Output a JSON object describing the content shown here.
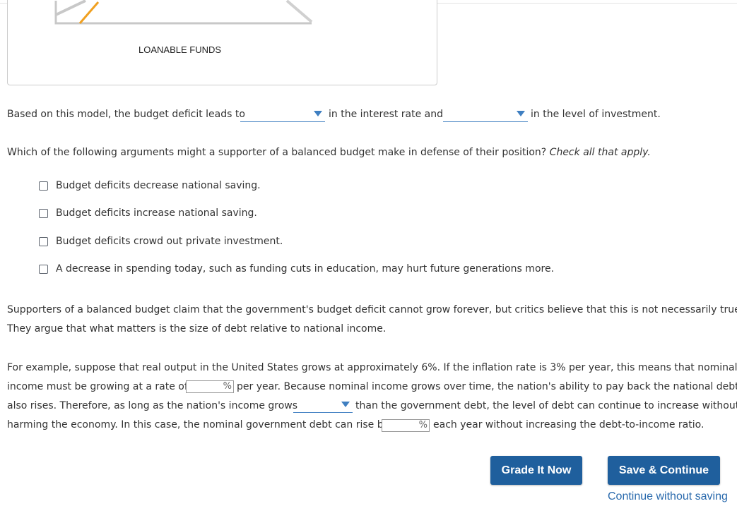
{
  "graph": {
    "x_axis_label": "LOANABLE FUNDS",
    "colors": {
      "curve": "#f0a020",
      "outline": "#c8c8c8"
    }
  },
  "q1": {
    "part1": "Based on this model, the budget deficit leads to",
    "part2": "in the interest rate and",
    "part3": "in the level of investment.",
    "dropdown1_value": "",
    "dropdown2_value": ""
  },
  "q2": {
    "prompt": "Which of the following arguments might a supporter of a balanced budget make in defense of their position?",
    "instruction": "Check all that apply.",
    "options": [
      "Budget deficits decrease national saving.",
      "Budget deficits increase national saving.",
      "Budget deficits crowd out private investment.",
      "A decrease in spending today, such as funding cuts in education, may hurt future generations more."
    ]
  },
  "para1": {
    "line1": "Supporters of a balanced budget claim that the government's budget deficit cannot grow forever, but critics believe that this is not necessarily true.",
    "line2": "They argue that what matters is the size of debt relative to national income."
  },
  "para2": {
    "l1": "For example, suppose that real output in the United States grows at approximately 6%. If the inflation rate is 3% per year, this means that nominal",
    "l2a": "income must be growing at a rate of",
    "l2b": "per year. Because nominal income grows over time, the nation's ability to pay back the national debt",
    "l3a": "also rises. Therefore, as long as the nation's income grows",
    "l3b": "than the government debt, the level of debt can continue to increase without",
    "l4a": "harming the economy. In this case, the nominal government debt can rise by",
    "l4b": "each year without increasing the debt-to-income ratio.",
    "pct_unit": "%",
    "input1_value": "",
    "input2_value": "",
    "dropdown3_value": ""
  },
  "actions": {
    "grade_label": "Grade It Now",
    "save_label": "Save & Continue",
    "continue_label": "Continue without saving",
    "button_color": "#1f5f9d"
  }
}
